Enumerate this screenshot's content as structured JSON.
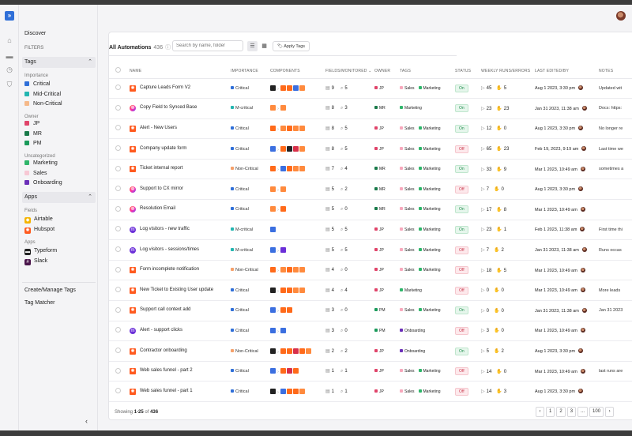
{
  "app": {
    "rail": [
      {
        "name": "home-icon",
        "glyph": "⌂"
      },
      {
        "name": "inbox-icon",
        "glyph": "▬"
      },
      {
        "name": "clock-icon",
        "glyph": "◷"
      },
      {
        "name": "shield-icon",
        "glyph": "⛉"
      }
    ]
  },
  "sidebar": {
    "discover": "Discover",
    "filters": "FILTERS",
    "tags_header": "Tags",
    "importance_label": "Importance",
    "importance": [
      {
        "label": "Critical",
        "color": "#2f6fd8"
      },
      {
        "label": "Mid-Critical",
        "color": "#22b5b0"
      },
      {
        "label": "Non-Critical",
        "color": "#f5b98a"
      }
    ],
    "owner_label": "Owner",
    "owners": [
      {
        "label": "JP",
        "color": "#e0446a"
      },
      {
        "label": "MR",
        "color": "#1a7a4a"
      },
      {
        "label": "PM",
        "color": "#1a9a5a"
      }
    ],
    "uncategorized_label": "Uncategorized",
    "uncategorized": [
      {
        "label": "Marketing",
        "color": "#2fb56a"
      },
      {
        "label": "Sales",
        "color": "#f7c8d4"
      },
      {
        "label": "Onboarding",
        "color": "#6b2fb8"
      }
    ],
    "apps_header": "Apps",
    "fields_label": "Fields",
    "fields": [
      {
        "label": "Airtable",
        "color": "#f5b400",
        "glyph": "◆"
      },
      {
        "label": "Hubspot",
        "color": "#ff5a1f",
        "glyph": "✺"
      }
    ],
    "apps_label": "Apps",
    "apps": [
      {
        "label": "Typeform",
        "color": "#222222",
        "glyph": "▬"
      },
      {
        "label": "Slack",
        "color": "#4a154b",
        "glyph": "#"
      }
    ],
    "create_manage": "Create/Manage Tags",
    "tag_matcher": "Tag Matcher",
    "collapse_glyph": "‹"
  },
  "header": {
    "title": "All Automations",
    "count": "436",
    "info_glyph": "ⓘ",
    "search_placeholder": "Search by name, folder",
    "list_view_glyph": "☰",
    "grid_view_glyph": "▦",
    "apply_tags": "Apply Tags",
    "apply_tags_glyph": "🏷"
  },
  "columns": [
    "NAME",
    "IMPORTANCE",
    "COMPONENTS",
    "FIELDS/MONITORED ⌄",
    "OWNER",
    "TAGS",
    "STATUS",
    "WEEKLY RUNS/ERRORS",
    "LAST EDITED/BY",
    "NOTES"
  ],
  "colors": {
    "Critical": "#2f6fd8",
    "M-critical": "#22b5b0",
    "Non-Critical": "#f5a06a",
    "JP": "#e0446a",
    "MR": "#1a7a4a",
    "PM": "#1a9a5a",
    "Sales": "#f7a8bc",
    "Marketing": "#2fb56a",
    "Onboarding": "#6b2fb8"
  },
  "icon_colors": {
    "zap": "#ff5a1f",
    "mk": "#ff5fa0",
    "bk": "#222222",
    "bl": "#3b6fe0",
    "og": "#ff6a1a",
    "pp": "#6b2fd8",
    "rd": "#d8304a",
    "ms": "#ff8a3d"
  },
  "rows": [
    {
      "name": "Capture Leads Form V2",
      "icon": "zap",
      "importance": "Critical",
      "components": [
        "bk",
        "og",
        "og",
        "bl",
        "ms"
      ],
      "fields": "9",
      "monitored": "5",
      "owner": "JP",
      "tags": [
        "Sales",
        "Marketing"
      ],
      "status": "On",
      "runs": "45",
      "errors": "5",
      "edited": "Aug 1 2023, 3:30 pm",
      "notes": "Updated wit"
    },
    {
      "name": "Copy Field to Synced Base",
      "icon": "mk",
      "importance": "M-critical",
      "components": [
        "ms",
        "ms"
      ],
      "fields": "8",
      "monitored": "3",
      "owner": "MR",
      "tags": [
        "Marketing"
      ],
      "status": "On",
      "runs": "23",
      "errors": "23",
      "edited": "Jan 31 2023, 11:38 am",
      "notes": "Docs: https:"
    },
    {
      "name": "Alert - New Users",
      "icon": "zap",
      "importance": "Critical",
      "components": [
        "og",
        "ms",
        "og",
        "ms",
        "ms"
      ],
      "fields": "8",
      "monitored": "5",
      "owner": "JP",
      "tags": [
        "Sales",
        "Marketing"
      ],
      "status": "On",
      "runs": "12",
      "errors": "0",
      "edited": "Aug 1 2023, 3:30 pm",
      "notes": "No longer re"
    },
    {
      "name": "Company update form",
      "icon": "zap",
      "importance": "Critical",
      "components": [
        "bl",
        "og",
        "bk",
        "rd",
        "ms"
      ],
      "fields": "8",
      "monitored": "5",
      "owner": "JP",
      "tags": [
        "Sales",
        "Marketing"
      ],
      "status": "Off",
      "runs": "65",
      "errors": "23",
      "edited": "Feb 19, 2023, 9:19 am",
      "notes": "Last time we"
    },
    {
      "name": "Ticket internal report",
      "icon": "zap",
      "importance": "Non-Critical",
      "components": [
        "og",
        "bl",
        "og",
        "ms",
        "ms"
      ],
      "fields": "7",
      "monitored": "4",
      "owner": "MR",
      "tags": [
        "Sales",
        "Marketing"
      ],
      "status": "On",
      "runs": "33",
      "errors": "9",
      "edited": "Mar 1 2023, 10:49 am",
      "notes": "sometimes a"
    },
    {
      "name": "Support to CX mirror",
      "icon": "mk",
      "importance": "Critical",
      "components": [
        "ms",
        "ms"
      ],
      "fields": "5",
      "monitored": "2",
      "owner": "MR",
      "tags": [
        "Sales",
        "Marketing"
      ],
      "status": "Off",
      "runs": "7",
      "errors": "0",
      "edited": "Aug 1 2023, 3:30 pm",
      "notes": ""
    },
    {
      "name": "Resolution Email",
      "icon": "mk",
      "importance": "Critical",
      "components": [
        "ms",
        "og"
      ],
      "fields": "5",
      "monitored": "0",
      "owner": "MR",
      "tags": [
        "Sales",
        "Marketing"
      ],
      "status": "On",
      "runs": "17",
      "errors": "8",
      "edited": "Mar 1 2023, 10:49 am",
      "notes": ""
    },
    {
      "name": "Log visitors - new traffic",
      "icon": "pd",
      "importance": "M-critical",
      "components": [
        "bl"
      ],
      "fields": "5",
      "monitored": "5",
      "owner": "JP",
      "tags": [
        "Sales",
        "Marketing"
      ],
      "status": "On",
      "runs": "23",
      "errors": "1",
      "edited": "Feb 1 2023, 11:38 am",
      "notes": "First time thi"
    },
    {
      "name": "Log visitors - sessions/times",
      "icon": "pd",
      "importance": "M-critical",
      "components": [
        "bl",
        "pp"
      ],
      "fields": "5",
      "monitored": "5",
      "owner": "JP",
      "tags": [
        "Sales",
        "Marketing"
      ],
      "status": "Off",
      "runs": "7",
      "errors": "2",
      "edited": "Jan 31 2023, 11:38 am",
      "notes": "Runs occas"
    },
    {
      "name": "Form incomplete notification",
      "icon": "zap",
      "importance": "Non-Critical",
      "components": [
        "og",
        "ms",
        "og",
        "ms",
        "ms"
      ],
      "fields": "4",
      "monitored": "0",
      "owner": "JP",
      "tags": [
        "Sales",
        "Marketing"
      ],
      "status": "Off",
      "runs": "18",
      "errors": "5",
      "edited": "Mar 1 2023, 10:49 am",
      "notes": ""
    },
    {
      "name": "New Ticket to Existing User update",
      "icon": "zap",
      "importance": "Critical",
      "components": [
        "bk",
        "og",
        "og",
        "ms",
        "ms"
      ],
      "fields": "4",
      "monitored": "4",
      "owner": "JP",
      "tags": [
        "Marketing"
      ],
      "status": "Off",
      "runs": "0",
      "errors": "0",
      "edited": "Mar 1 2023, 10:49 am",
      "notes": "More leads"
    },
    {
      "name": "Support call context add",
      "icon": "zap",
      "importance": "Critical",
      "components": [
        "bl",
        "og",
        "og"
      ],
      "fields": "3",
      "monitored": "0",
      "owner": "PM",
      "tags": [
        "Sales",
        "Marketing"
      ],
      "status": "On",
      "runs": "0",
      "errors": "0",
      "edited": "Jan 31 2023, 11:38 am",
      "notes": "Jan 31 2023"
    },
    {
      "name": "Alert - support clicks",
      "icon": "pd",
      "importance": "Critical",
      "components": [
        "bl",
        "bl"
      ],
      "fields": "3",
      "monitored": "0",
      "owner": "PM",
      "tags": [
        "Onboarding"
      ],
      "status": "Off",
      "runs": "3",
      "errors": "0",
      "edited": "Mar 1 2023, 10:49 am",
      "notes": ""
    },
    {
      "name": "Contractor onboarding",
      "icon": "zap",
      "importance": "Non-Critical",
      "components": [
        "bk",
        "og",
        "og",
        "rd",
        "og",
        "ms"
      ],
      "fields": "2",
      "monitored": "2",
      "owner": "JP",
      "tags": [
        "Onboarding"
      ],
      "status": "On",
      "runs": "5",
      "errors": "2",
      "edited": "Aug 1 2023, 3:30 pm",
      "notes": ""
    },
    {
      "name": "Web sales funnel - part 2",
      "icon": "zap",
      "importance": "Critical",
      "components": [
        "bl",
        "og",
        "rd",
        "og"
      ],
      "fields": "1",
      "monitored": "1",
      "owner": "JP",
      "tags": [
        "Sales",
        "Marketing"
      ],
      "status": "Off",
      "runs": "14",
      "errors": "0",
      "edited": "Mar 1 2023, 10:49 am",
      "notes": "last runs are"
    },
    {
      "name": "Web sales funnel - part 1",
      "icon": "zap",
      "importance": "Critical",
      "components": [
        "bk",
        "bl",
        "og",
        "og",
        "ms"
      ],
      "fields": "1",
      "monitored": "1",
      "owner": "JP",
      "tags": [
        "Sales",
        "Marketing"
      ],
      "status": "Off",
      "runs": "14",
      "errors": "3",
      "edited": "Aug 1 2023, 3:30 pm",
      "notes": ""
    }
  ],
  "footer": {
    "showing_prefix": "Showing",
    "range": "1-25",
    "of": "of",
    "total": "436",
    "pages": [
      "‹",
      "1",
      "2",
      "3",
      "...",
      "100",
      "›"
    ]
  }
}
